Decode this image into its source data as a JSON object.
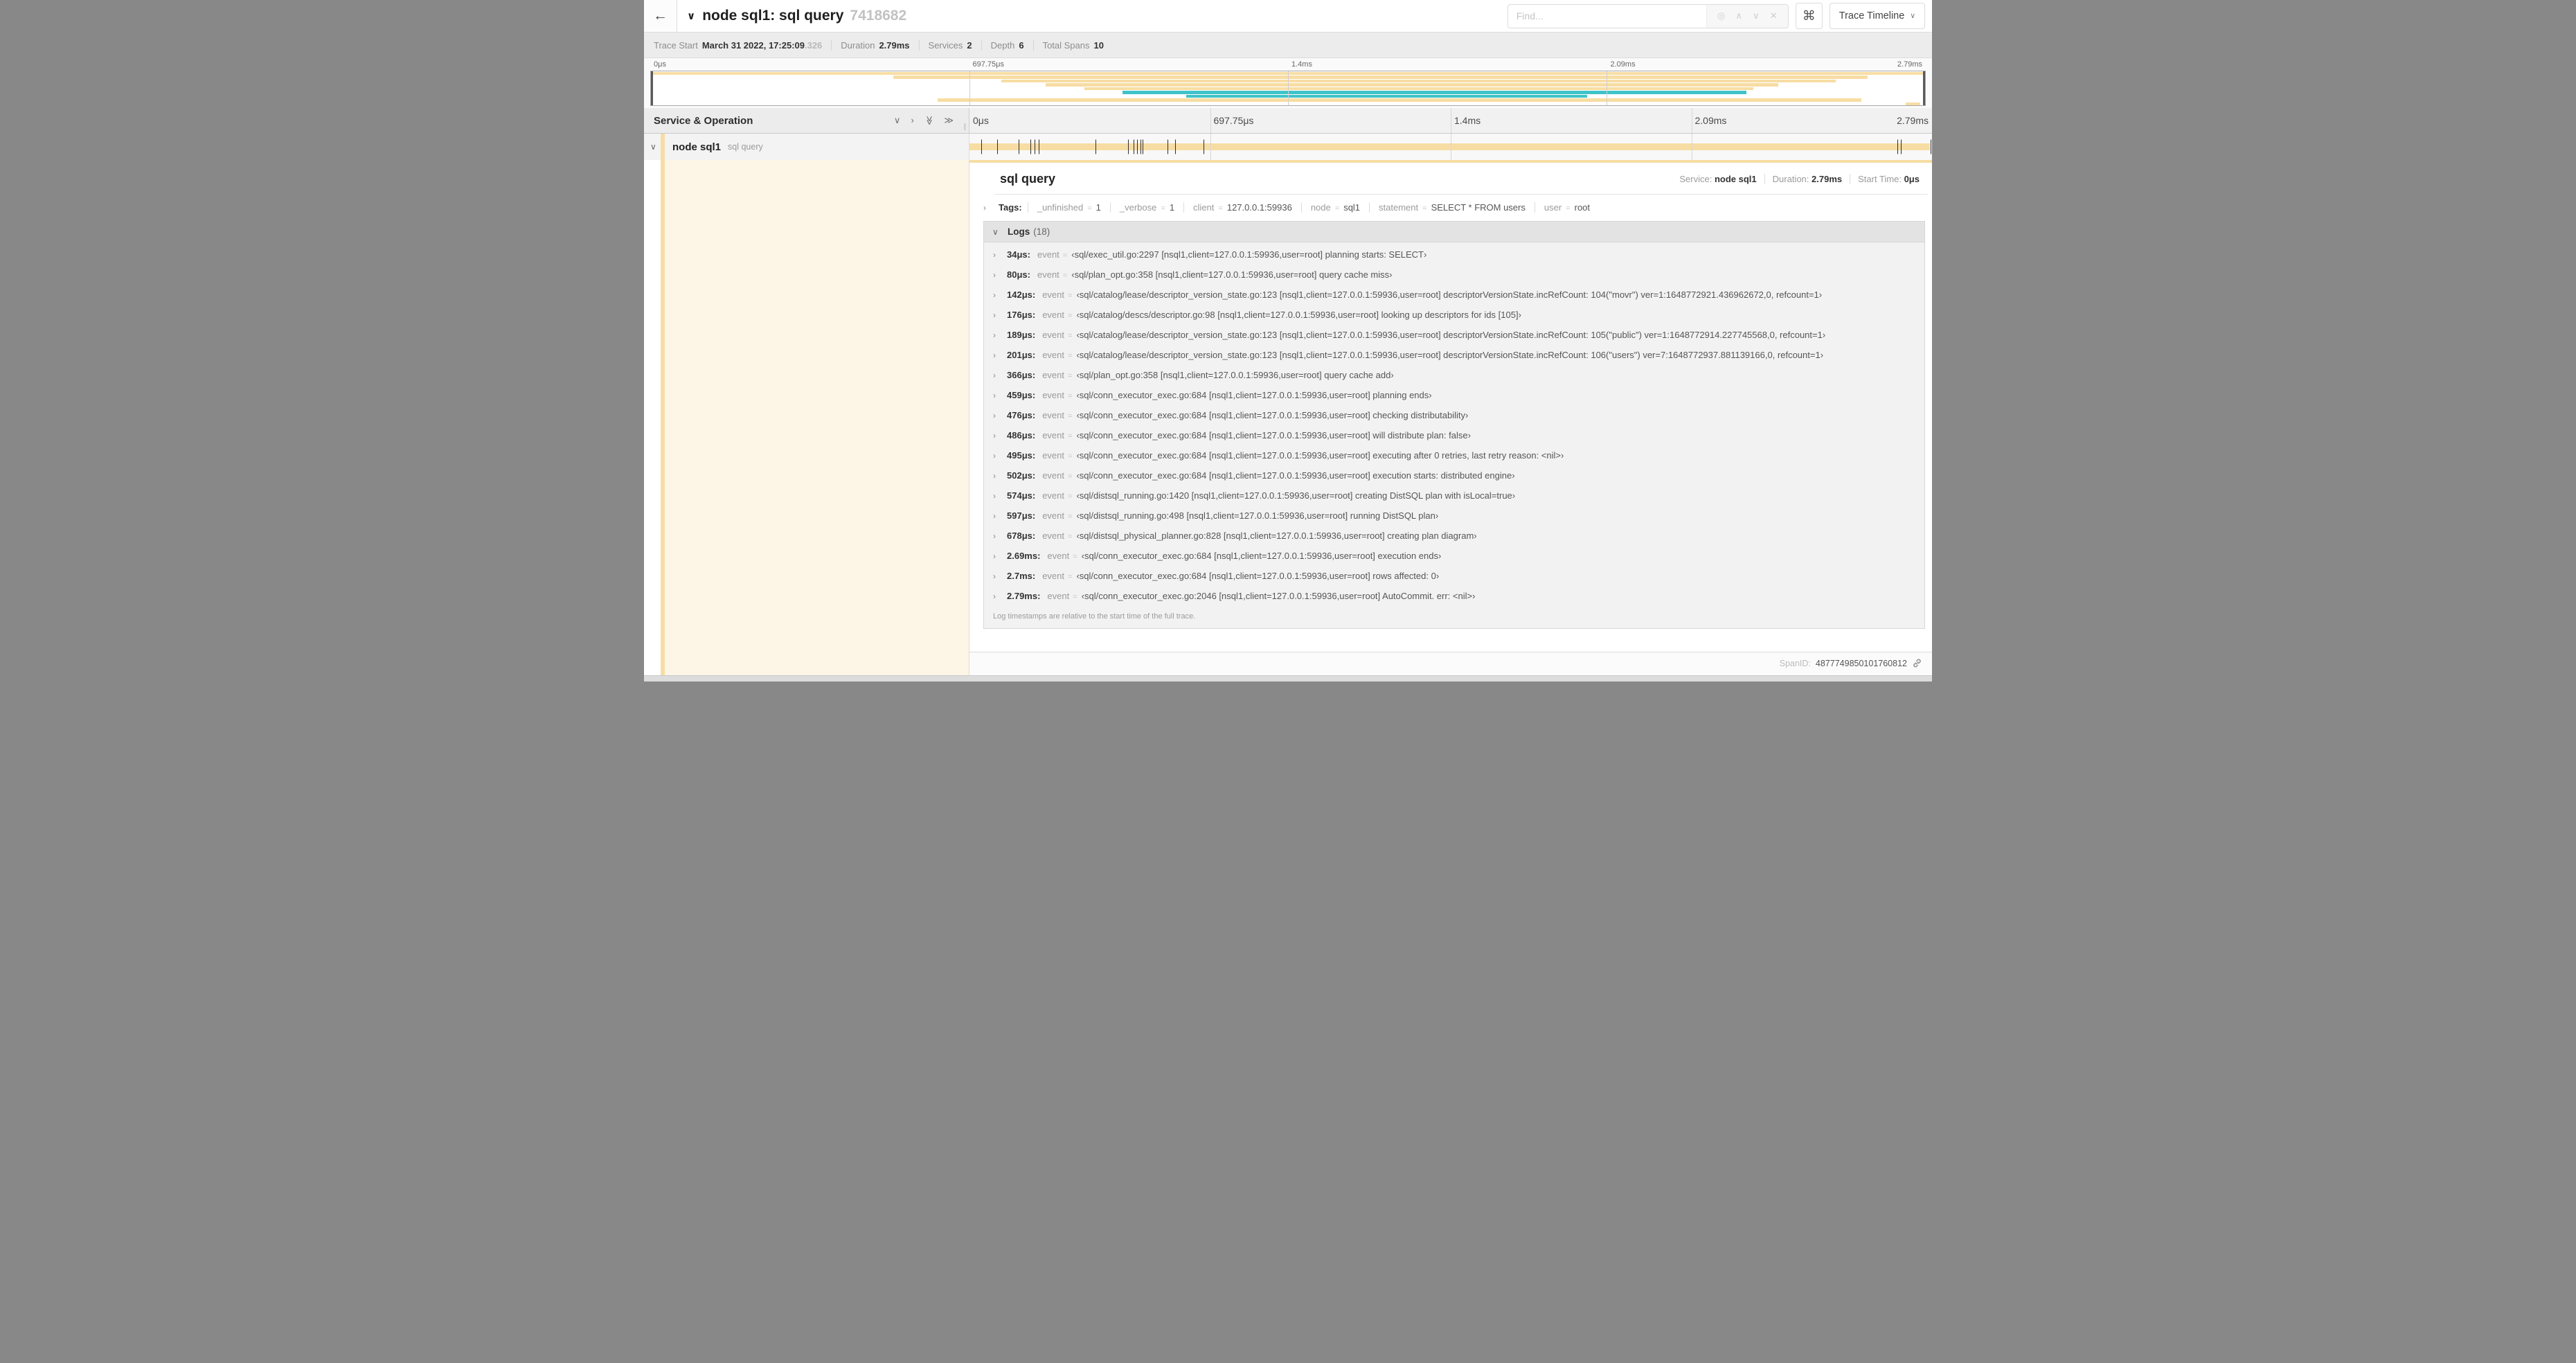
{
  "icons": {
    "back": "←",
    "chevron_down": "∨",
    "chevron_right": "›",
    "expand_one": "∨",
    "collapse_one": "›",
    "expand_all": "≫",
    "collapse_all": "≫",
    "locate": "◎",
    "prev_match": "∧",
    "next_match": "∨",
    "clear_find": "✕",
    "command": "⌘",
    "grip": "∥"
  },
  "header": {
    "title": "node sql1: sql query",
    "trace_id": "7418682",
    "find_placeholder": "Find...",
    "view_selector": "Trace Timeline"
  },
  "summary": {
    "items": [
      {
        "label": "Trace Start",
        "value": "March 31 2022, 17:25:09",
        "suffix": ".326"
      },
      {
        "label": "Duration",
        "value": "2.79ms"
      },
      {
        "label": "Services",
        "value": "2"
      },
      {
        "label": "Depth",
        "value": "6"
      },
      {
        "label": "Total Spans",
        "value": "10"
      }
    ]
  },
  "minimap": {
    "ticks": [
      {
        "label": "0μs",
        "pct": 0
      },
      {
        "label": "697.75μs",
        "pct": 25
      },
      {
        "label": "1.4ms",
        "pct": 50
      },
      {
        "label": "2.09ms",
        "pct": 75
      },
      {
        "label": "2.79ms",
        "pct": 100
      }
    ],
    "spans": [
      {
        "start": 0,
        "end": 100,
        "color": "tan"
      },
      {
        "start": 19,
        "end": 95.5,
        "color": "tan"
      },
      {
        "start": 27.5,
        "end": 93,
        "color": "tan"
      },
      {
        "start": 31,
        "end": 88.5,
        "color": "tan"
      },
      {
        "start": 34,
        "end": 86.5,
        "color": "tan"
      },
      {
        "start": 37,
        "end": 86,
        "color": "teal"
      },
      {
        "start": 42,
        "end": 73.5,
        "color": "teal"
      },
      {
        "start": 22.5,
        "end": 95,
        "color": "tan"
      },
      {
        "start": 98.5,
        "end": 99.6,
        "color": "tan"
      }
    ],
    "gridlines_pct": [
      25,
      50,
      75
    ]
  },
  "timeline": {
    "header": "Service & Operation",
    "ticks": [
      {
        "label": "0μs",
        "pct": 0
      },
      {
        "label": "697.75μs",
        "pct": 25
      },
      {
        "label": "1.4ms",
        "pct": 50
      },
      {
        "label": "2.09ms",
        "pct": 75
      },
      {
        "label": "2.79ms",
        "pct": 100
      }
    ],
    "gridlines_pct": [
      25,
      50,
      75
    ]
  },
  "span_row": {
    "service": "node sql1",
    "operation": "sql query",
    "total_us": 2790
  },
  "detail": {
    "title": "sql query",
    "overview": [
      {
        "label": "Service:",
        "value": "node sql1"
      },
      {
        "label": "Duration:",
        "value": "2.79ms"
      },
      {
        "label": "Start Time:",
        "value": "0μs"
      }
    ],
    "tags_label": "Tags:",
    "tags": [
      {
        "key": "_unfinished",
        "value": "1"
      },
      {
        "key": "_verbose",
        "value": "1"
      },
      {
        "key": "client",
        "value": "127.0.0.1:59936"
      },
      {
        "key": "node",
        "value": "sql1"
      },
      {
        "key": "statement",
        "value": "SELECT * FROM users"
      },
      {
        "key": "user",
        "value": "root"
      }
    ],
    "logs_label": "Logs",
    "logs_count": "(18)",
    "logs": [
      {
        "t_us": 34,
        "time": "34μs:",
        "key": "event",
        "value": "‹sql/exec_util.go:2297 [nsql1,client=127.0.0.1:59936,user=root] planning starts: SELECT›"
      },
      {
        "t_us": 80,
        "time": "80μs:",
        "key": "event",
        "value": "‹sql/plan_opt.go:358 [nsql1,client=127.0.0.1:59936,user=root] query cache miss›"
      },
      {
        "t_us": 142,
        "time": "142μs:",
        "key": "event",
        "value": "‹sql/catalog/lease/descriptor_version_state.go:123 [nsql1,client=127.0.0.1:59936,user=root] descriptorVersionState.incRefCount: 104(\"movr\") ver=1:1648772921.436962672,0, refcount=1›"
      },
      {
        "t_us": 176,
        "time": "176μs:",
        "key": "event",
        "value": "‹sql/catalog/descs/descriptor.go:98 [nsql1,client=127.0.0.1:59936,user=root] looking up descriptors for ids [105]›"
      },
      {
        "t_us": 189,
        "time": "189μs:",
        "key": "event",
        "value": "‹sql/catalog/lease/descriptor_version_state.go:123 [nsql1,client=127.0.0.1:59936,user=root] descriptorVersionState.incRefCount: 105(\"public\") ver=1:1648772914.227745568,0, refcount=1›"
      },
      {
        "t_us": 201,
        "time": "201μs:",
        "key": "event",
        "value": "‹sql/catalog/lease/descriptor_version_state.go:123 [nsql1,client=127.0.0.1:59936,user=root] descriptorVersionState.incRefCount: 106(\"users\") ver=7:1648772937.881139166,0, refcount=1›"
      },
      {
        "t_us": 366,
        "time": "366μs:",
        "key": "event",
        "value": "‹sql/plan_opt.go:358 [nsql1,client=127.0.0.1:59936,user=root] query cache add›"
      },
      {
        "t_us": 459,
        "time": "459μs:",
        "key": "event",
        "value": "‹sql/conn_executor_exec.go:684 [nsql1,client=127.0.0.1:59936,user=root] planning ends›"
      },
      {
        "t_us": 476,
        "time": "476μs:",
        "key": "event",
        "value": "‹sql/conn_executor_exec.go:684 [nsql1,client=127.0.0.1:59936,user=root] checking distributability›"
      },
      {
        "t_us": 486,
        "time": "486μs:",
        "key": "event",
        "value": "‹sql/conn_executor_exec.go:684 [nsql1,client=127.0.0.1:59936,user=root] will distribute plan: false›"
      },
      {
        "t_us": 495,
        "time": "495μs:",
        "key": "event",
        "value": "‹sql/conn_executor_exec.go:684 [nsql1,client=127.0.0.1:59936,user=root] executing after 0 retries, last retry reason: <nil>›"
      },
      {
        "t_us": 502,
        "time": "502μs:",
        "key": "event",
        "value": "‹sql/conn_executor_exec.go:684 [nsql1,client=127.0.0.1:59936,user=root] execution starts: distributed engine›"
      },
      {
        "t_us": 574,
        "time": "574μs:",
        "key": "event",
        "value": "‹sql/distsql_running.go:1420 [nsql1,client=127.0.0.1:59936,user=root] creating DistSQL plan with isLocal=true›"
      },
      {
        "t_us": 597,
        "time": "597μs:",
        "key": "event",
        "value": "‹sql/distsql_running.go:498 [nsql1,client=127.0.0.1:59936,user=root] running DistSQL plan›"
      },
      {
        "t_us": 678,
        "time": "678μs:",
        "key": "event",
        "value": "‹sql/distsql_physical_planner.go:828 [nsql1,client=127.0.0.1:59936,user=root] creating plan diagram›"
      },
      {
        "t_us": 2690,
        "time": "2.69ms:",
        "key": "event",
        "value": "‹sql/conn_executor_exec.go:684 [nsql1,client=127.0.0.1:59936,user=root] execution ends›"
      },
      {
        "t_us": 2700,
        "time": "2.7ms:",
        "key": "event",
        "value": "‹sql/conn_executor_exec.go:684 [nsql1,client=127.0.0.1:59936,user=root] rows affected: 0›"
      },
      {
        "t_us": 2790,
        "time": "2.79ms:",
        "key": "event",
        "value": "‹sql/conn_executor_exec.go:2046 [nsql1,client=127.0.0.1:59936,user=root] AutoCommit. err: <nil>›"
      }
    ],
    "footnote": "Log timestamps are relative to the start time of the full trace.",
    "spanid_label": "SpanID:",
    "spanid": "4877749850101760812"
  },
  "colors": {
    "span_tan": "#f7dda4",
    "span_teal": "#3fc3c9",
    "selected_row_bg": "#f3f3f3"
  }
}
